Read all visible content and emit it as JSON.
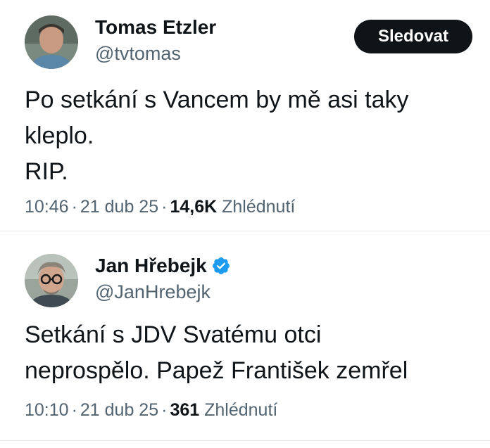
{
  "tweets": [
    {
      "display_name": "Tomas Etzler",
      "handle": "@tvtomas",
      "follow_label": "Sledovat",
      "body_lines": [
        "Po setkání s Vancem by mě asi taky",
        "kleplo.",
        "RIP."
      ],
      "time": "10:46",
      "date": "21 dub 25",
      "views_count": "14,6K",
      "views_label": "Zhlédnutí",
      "separator": "·"
    },
    {
      "display_name": "Jan Hřebejk",
      "handle": "@JanHrebejk",
      "verified_icon": "verified-badge-icon",
      "body_lines": [
        "Setkání s JDV Svatému otci",
        "neprospělo. Papež František zemřel"
      ],
      "time": "10:10",
      "date": "21 dub 25",
      "views_count": "361",
      "views_label": "Zhlédnutí",
      "separator": "·"
    }
  ],
  "colors": {
    "text_primary": "#0f1419",
    "text_secondary": "#536471",
    "verified_blue": "#1d9bf0",
    "follow_button_bg": "#0f1419",
    "divider": "#e6e9eb"
  }
}
